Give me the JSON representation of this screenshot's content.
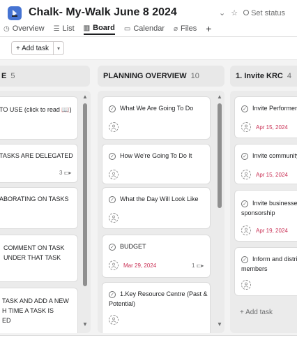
{
  "project": {
    "title": "Chalk- My-Walk June 8 2024",
    "set_status_label": "Set status",
    "icon": "project-icon"
  },
  "tabs": [
    {
      "label": "Overview",
      "icon": "overview-icon"
    },
    {
      "label": "List",
      "icon": "list-icon"
    },
    {
      "label": "Board",
      "icon": "board-icon",
      "active": true
    },
    {
      "label": "Calendar",
      "icon": "calendar-icon"
    },
    {
      "label": "Files",
      "icon": "files-icon"
    }
  ],
  "toolbar": {
    "add_task_label": "+ Add task"
  },
  "columns": [
    {
      "name": "E",
      "count": "5",
      "cards": [
        {
          "title": "TO USE (click to read 📖)"
        },
        {
          "title": "TASKS ARE DELEGATED",
          "subtasks": "3"
        },
        {
          "title": "ABORATING ON TASKS"
        },
        {
          "title_line1": "COMMENT ON TASK",
          "title_line2": "UNDER THAT TASK"
        },
        {
          "title_line1": "TASK AND ADD A NEW",
          "title_line2": "H TIME A TASK IS",
          "title_line3": "ED"
        }
      ]
    },
    {
      "name": "PLANNING OVERVIEW",
      "count": "10",
      "cards": [
        {
          "title": "What We Are Going To Do"
        },
        {
          "title": "How We're Going To Do It"
        },
        {
          "title": "What the Day Will Look Like"
        },
        {
          "title": "BUDGET",
          "due": "Mar 29, 2024",
          "subtasks": "1"
        },
        {
          "title_line1": "1.Key Resource Centre (Past &",
          "title_line2": "Potential)"
        }
      ]
    },
    {
      "name": "1. Invite KRC",
      "count": "4",
      "cards": [
        {
          "title": "Invite Performers",
          "due": "Apr 15, 2024"
        },
        {
          "title": "Invite community",
          "due": "Apr 15, 2024"
        },
        {
          "title_line1": "Invite businesses",
          "title_line2": "sponsorship",
          "due": "Apr 19, 2024"
        },
        {
          "title_line1": "Inform and distrib",
          "title_line2": "members"
        }
      ],
      "add_task_label": "+ Add task"
    }
  ],
  "colors": {
    "accent": "#4573d2",
    "due_red": "#c92f54"
  }
}
